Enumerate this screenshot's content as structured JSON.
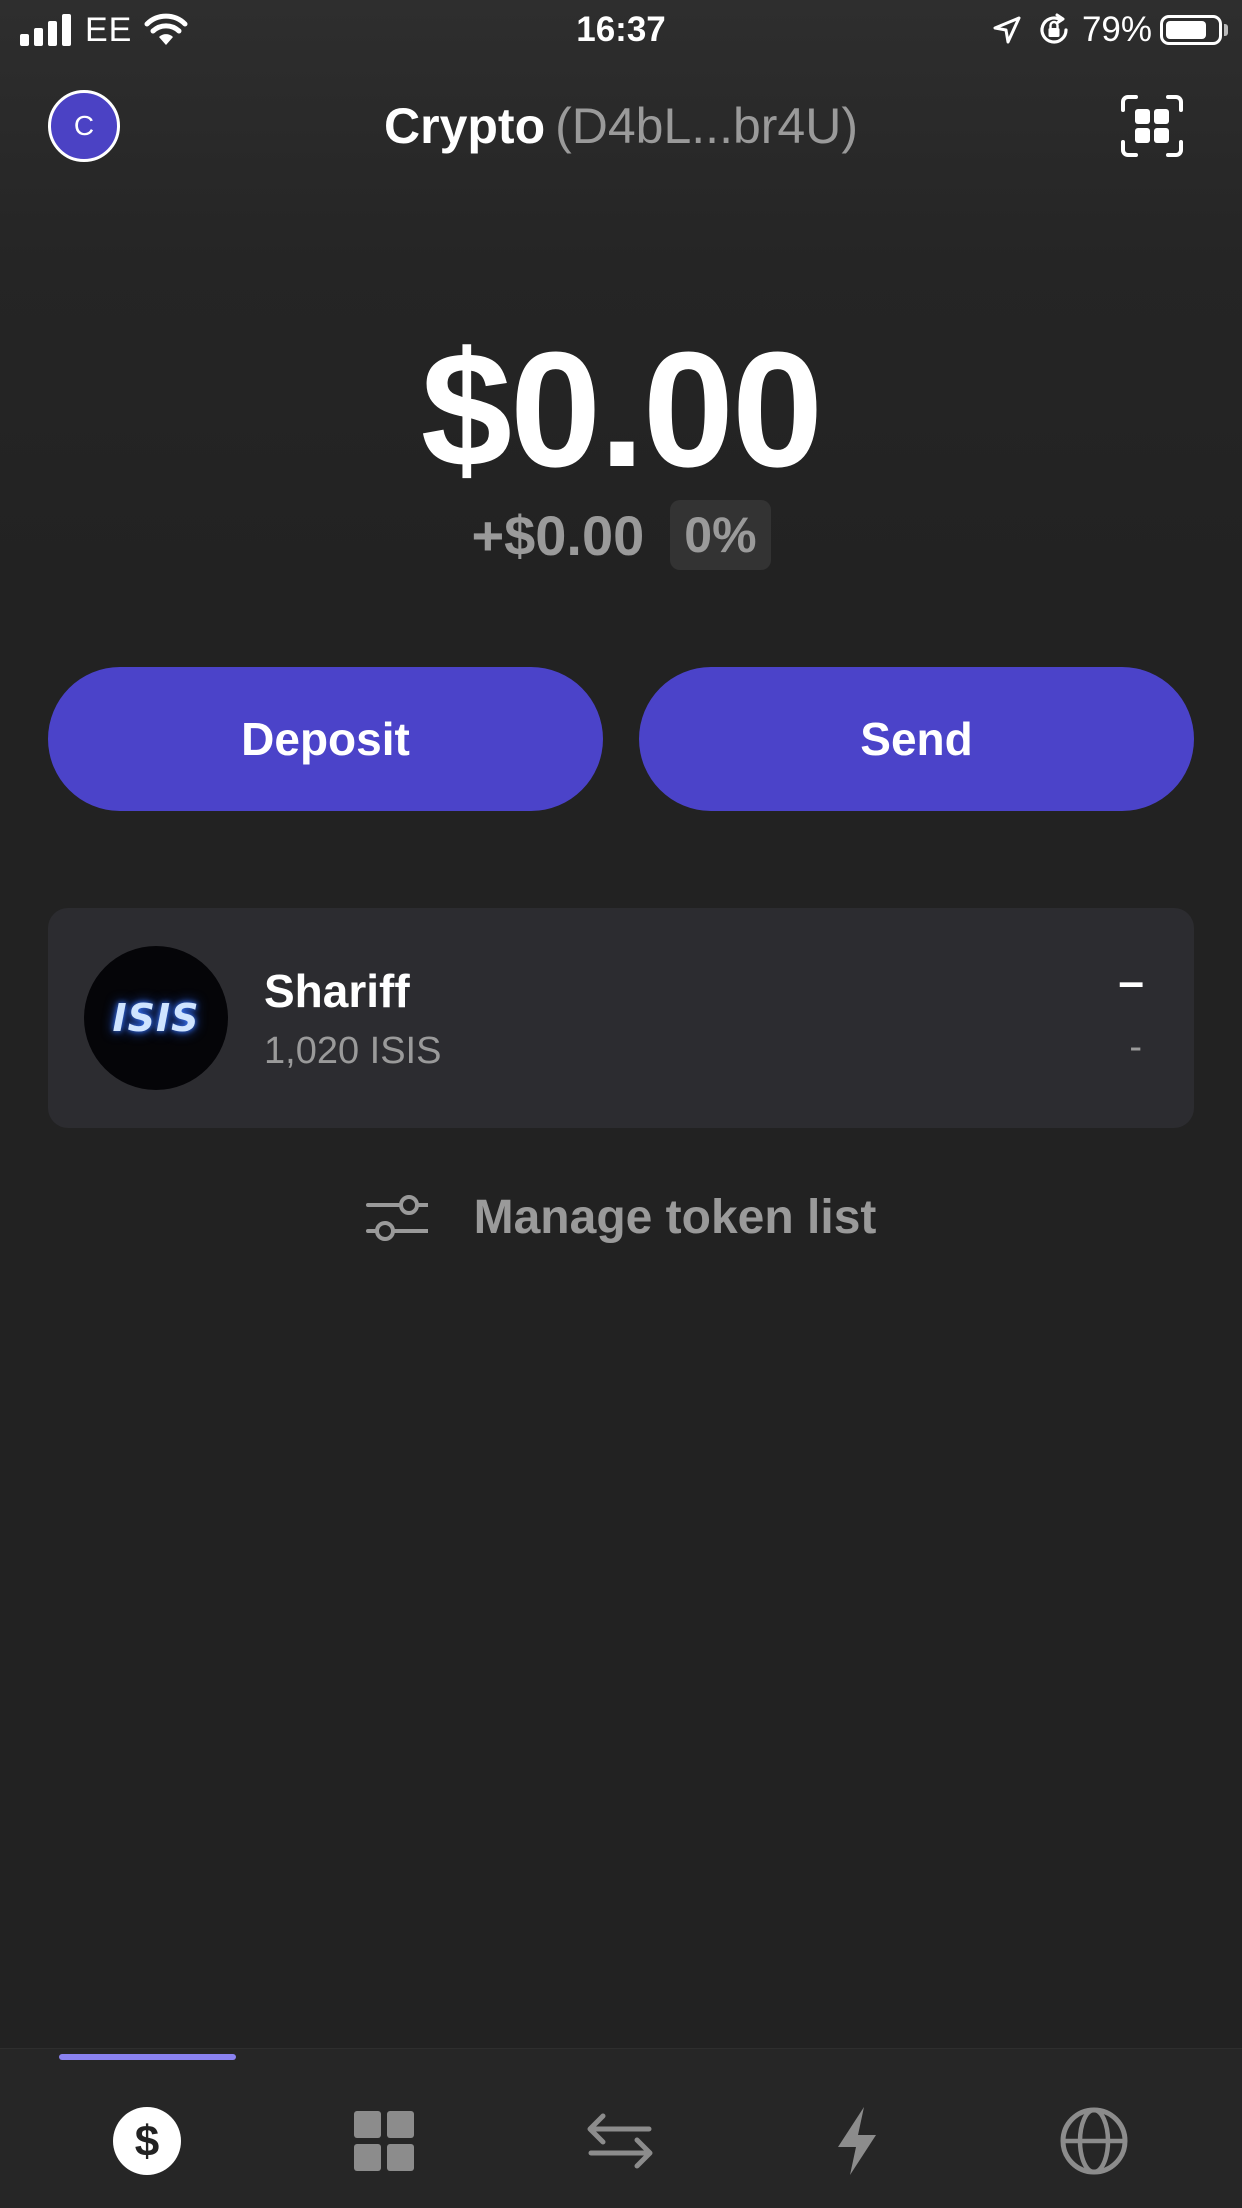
{
  "status_bar": {
    "carrier": "EE",
    "time": "16:37",
    "battery": "79%",
    "battery_level": 0.79
  },
  "header": {
    "avatar_initial": "C",
    "title": "Crypto",
    "address": "(D4bL...br4U)",
    "scan_icon": "qr-scan-icon"
  },
  "balance": {
    "total": "$0.00",
    "change_amount": "+$0.00",
    "change_percent": "0%"
  },
  "actions": {
    "deposit_label": "Deposit",
    "send_label": "Send"
  },
  "tokens": [
    {
      "logo_text": "ISIS",
      "name": "Shariff",
      "amount": "1,020 ISIS",
      "value": "–",
      "change": "-"
    }
  ],
  "manage": {
    "label": "Manage token list",
    "icon": "sliders-icon"
  },
  "tab_bar": {
    "tabs": [
      {
        "icon": "dollar-icon",
        "active": true
      },
      {
        "icon": "grid-icon",
        "active": false
      },
      {
        "icon": "swap-icon",
        "active": false
      },
      {
        "icon": "lightning-icon",
        "active": false
      },
      {
        "icon": "globe-icon",
        "active": false
      }
    ],
    "accent": "#8a82f0"
  },
  "colors": {
    "background": "#222222",
    "button": "#4b43c9",
    "card": "#2c2c30",
    "muted_text": "#9a9a9a"
  }
}
